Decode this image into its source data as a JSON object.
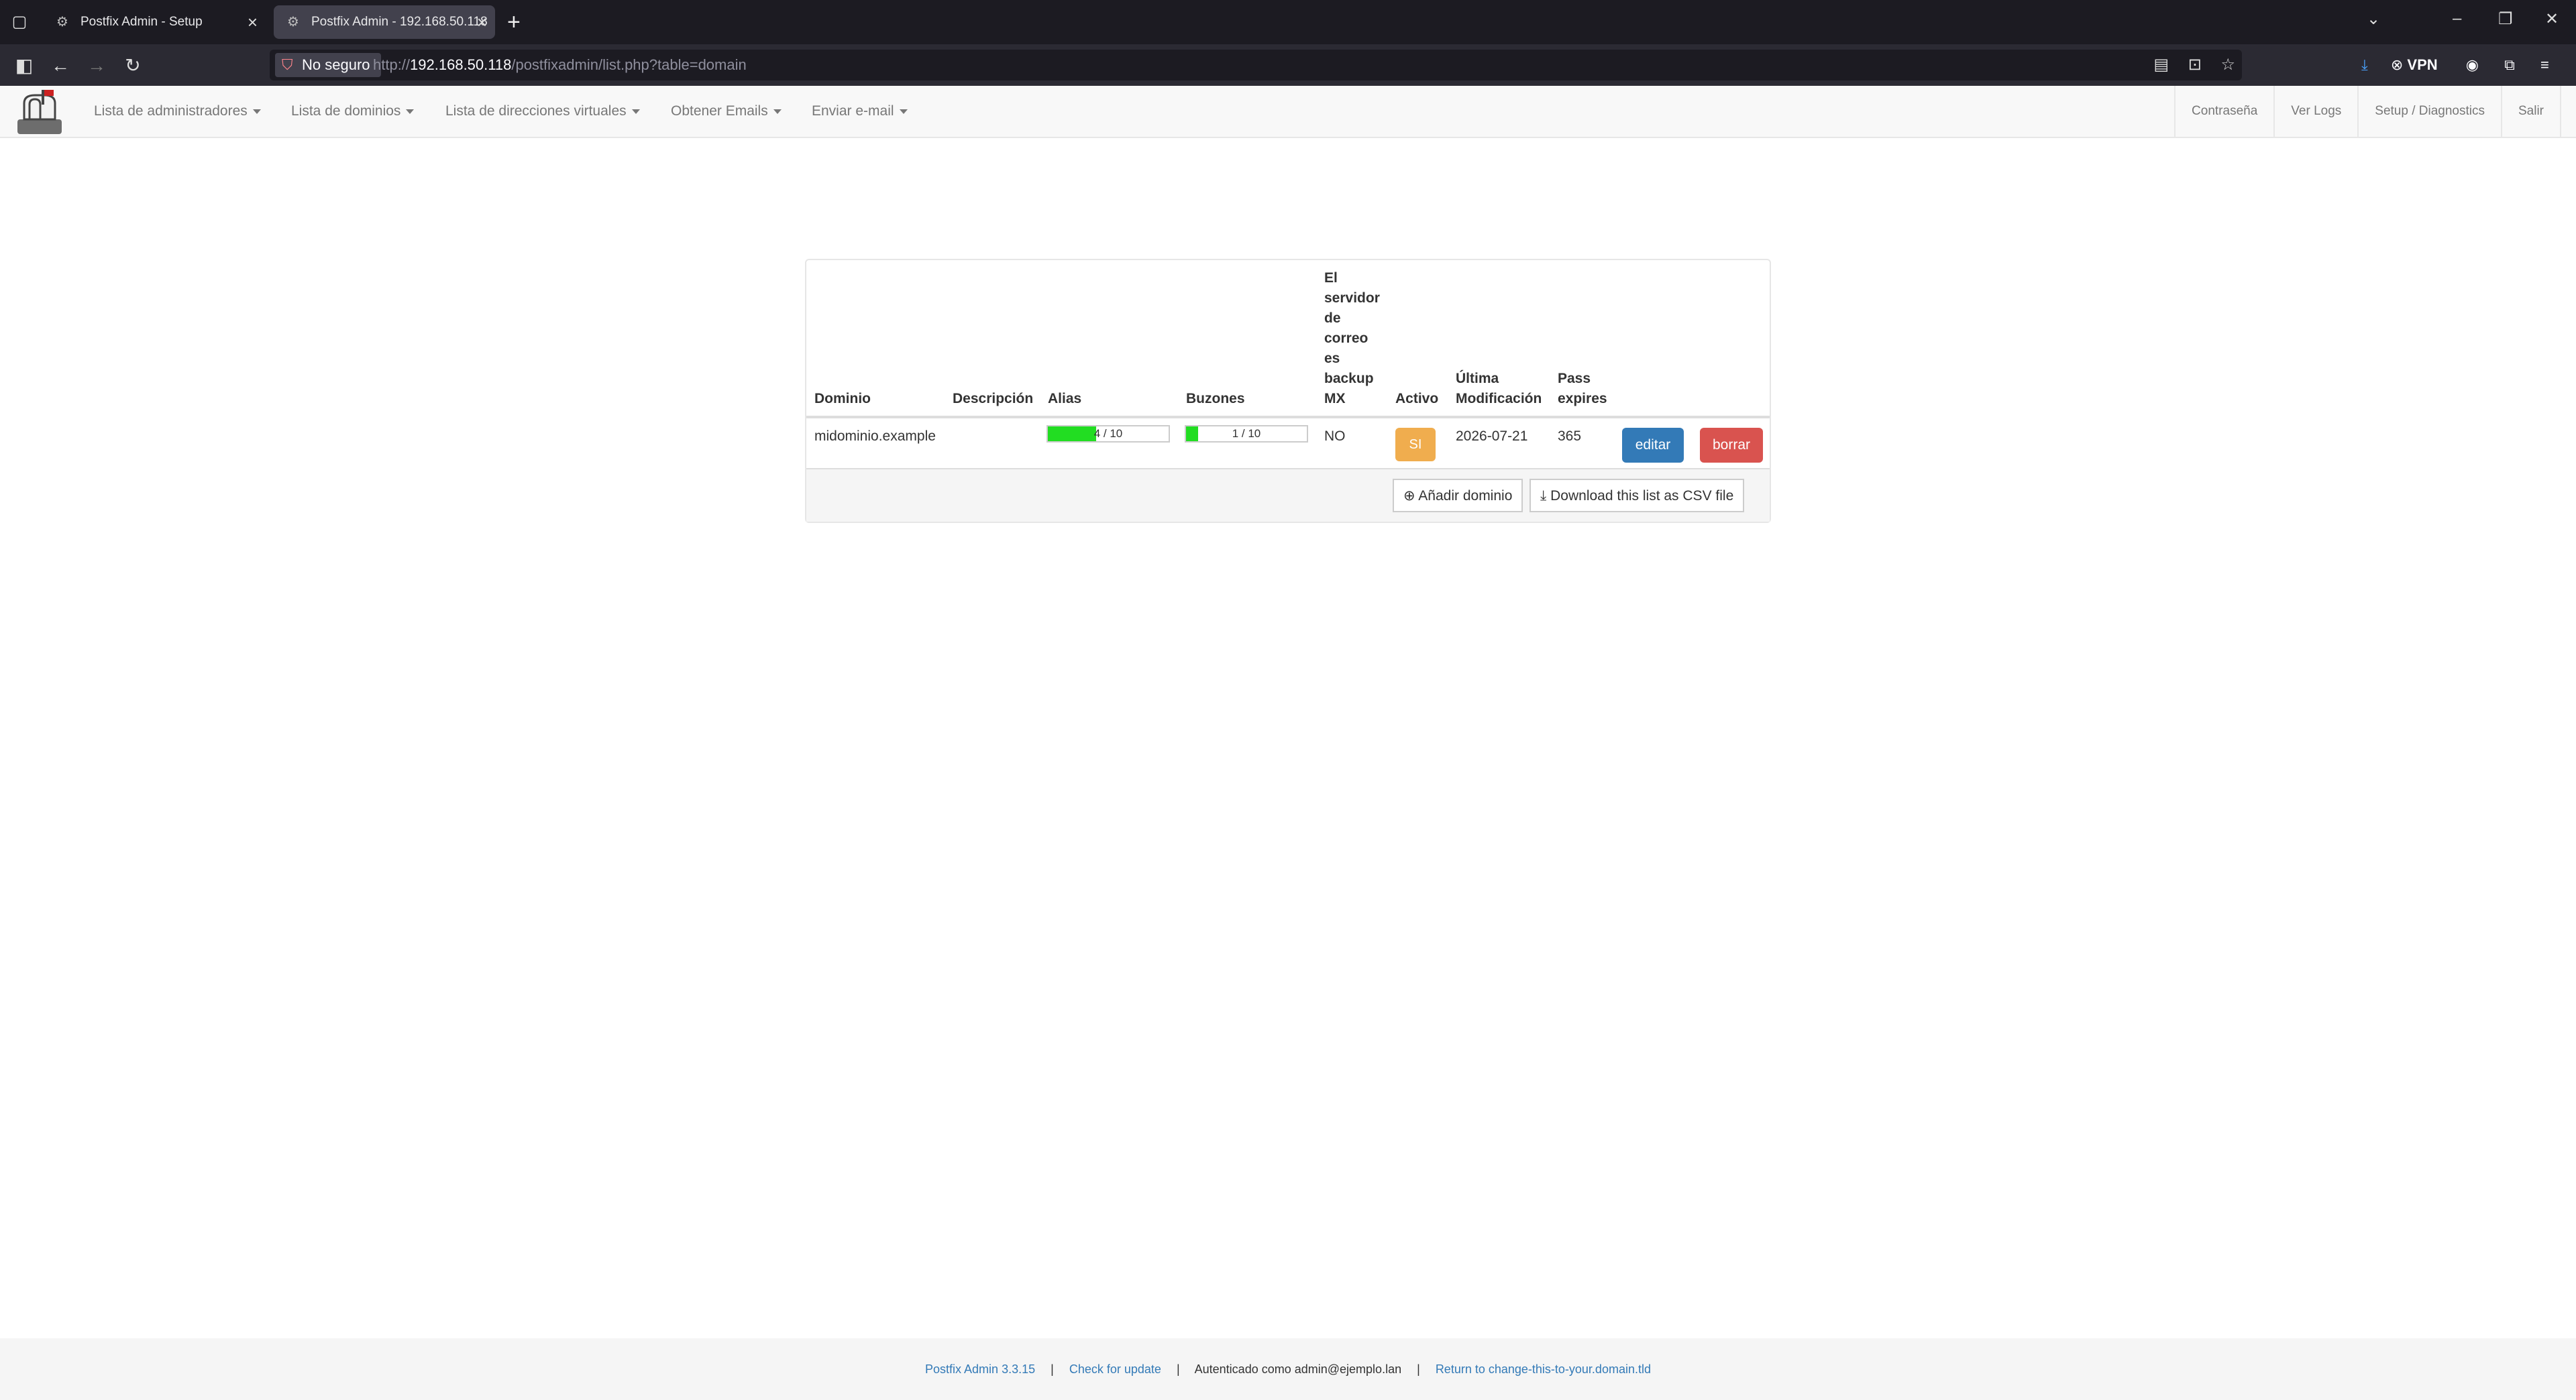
{
  "browser": {
    "tabs": [
      {
        "title": "Postfix Admin - Setup"
      },
      {
        "title": "Postfix Admin - 192.168.50.118"
      }
    ],
    "security_label": "No seguro",
    "url_scheme": "http://",
    "url_host": "192.168.50.118",
    "url_path": "/postfixadmin/list.php?table=domain",
    "vpn_label": "VPN"
  },
  "menu": {
    "items": [
      {
        "label": "Lista de administradores"
      },
      {
        "label": "Lista de dominios"
      },
      {
        "label": "Lista de direcciones virtuales"
      },
      {
        "label": "Obtener Emails"
      },
      {
        "label": "Enviar e-mail"
      }
    ],
    "right": [
      {
        "label": "Contraseña"
      },
      {
        "label": "Ver Logs"
      },
      {
        "label": "Setup / Diagnostics"
      },
      {
        "label": "Salir"
      }
    ]
  },
  "table": {
    "headers": {
      "domain": "Dominio",
      "description": "Descripción",
      "aliases": "Alias",
      "mailboxes": "Buzones",
      "backup_mx_lines": [
        "El",
        "servidor",
        "de",
        "correo",
        "es",
        "backup",
        "MX"
      ],
      "active": "Activo",
      "modified_lines": [
        "Última",
        "Modificación"
      ],
      "pass_expires_lines": [
        "Pass",
        "expires"
      ]
    },
    "rows": [
      {
        "domain": "midominio.example",
        "description": "",
        "aliases_text": "4 / 10",
        "aliases_fraction": 0.4,
        "mailboxes_text": "1 / 10",
        "mailboxes_fraction": 0.1,
        "backup_mx": "NO",
        "active": "SI",
        "modified": "2026-07-21",
        "pass_expires": "365",
        "edit_label": "editar",
        "delete_label": "borrar"
      }
    ],
    "add_domain_label": "Añadir dominio",
    "csv_label": "Download this list as CSV file"
  },
  "colors": {
    "edit": "#337ab7",
    "delete": "#d9534f",
    "active_badge": "#f0ad4e",
    "progress": "#22dd22"
  },
  "footer": {
    "version": "Postfix Admin 3.3.15",
    "check_update": "Check for update",
    "logged_in": "Autenticado como admin@ejemplo.lan",
    "return_link": "Return to change-this-to-your.domain.tld"
  }
}
